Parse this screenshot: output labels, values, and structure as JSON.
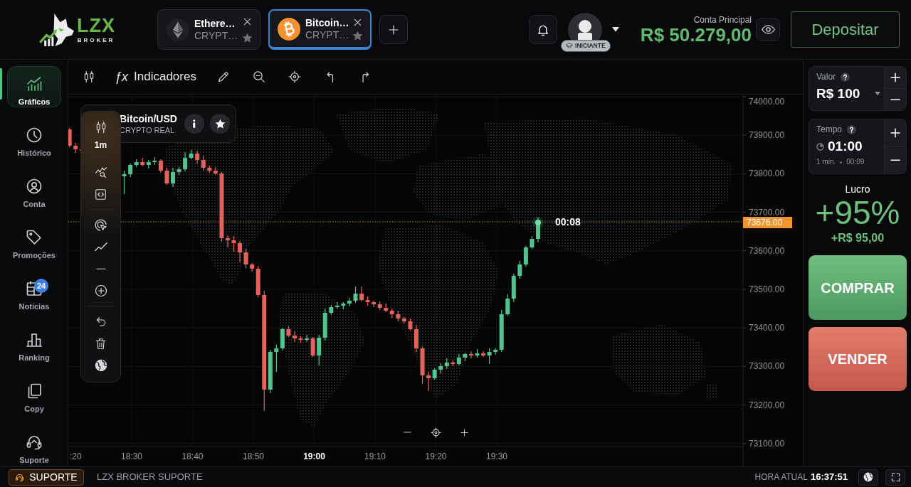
{
  "logo": {
    "wordmark": "LZX",
    "tagline": "BROKER"
  },
  "asset_tabs": [
    {
      "kind": "ethereum",
      "name": "Ethere…",
      "category": "CRYPT…",
      "selected": false
    },
    {
      "kind": "bitcoin",
      "name": "Bitcoin…",
      "category": "CRYPT…",
      "selected": true
    }
  ],
  "account": {
    "level_badge": "INICIANTE",
    "label": "Conta Principal",
    "balance": "R$ 50.279,00",
    "deposit_button": "Depositar"
  },
  "sidebar": {
    "items": [
      {
        "kind": "charts",
        "label": "Gráficos",
        "selected": true
      },
      {
        "kind": "history",
        "label": "Histórico",
        "selected": false
      },
      {
        "kind": "account",
        "label": "Conta",
        "selected": false
      },
      {
        "kind": "promotions",
        "label": "Promoções",
        "selected": false
      },
      {
        "kind": "news",
        "label": "Notícias",
        "selected": false,
        "badge": "24"
      },
      {
        "kind": "ranking",
        "label": "Ranking",
        "selected": false
      },
      {
        "kind": "copy",
        "label": "Copy",
        "selected": false
      },
      {
        "kind": "support",
        "label": "Suporte",
        "selected": false
      }
    ]
  },
  "chart_toolbar": {
    "indicators_symbol": "ƒx",
    "indicators_label": "Indicadores"
  },
  "asset_card": {
    "name": "Bitcoin/USD",
    "category": "CRYPTO REAL"
  },
  "drawing_tools": {
    "timeframe": "1m"
  },
  "chart": {
    "price_labels": [
      "74000.00",
      "73900.00",
      "73800.00",
      "73700.00",
      "73600.00",
      "73500.00",
      "73400.00",
      "73300.00",
      "73200.00",
      "73100.00"
    ],
    "current_price": "73676.00",
    "countdown": "00:08",
    "time_labels": [
      {
        "label": ":20",
        "major": false
      },
      {
        "label": "18:30",
        "major": false
      },
      {
        "label": "18:40",
        "major": false
      },
      {
        "label": "18:50",
        "major": false
      },
      {
        "label": "19:00",
        "major": true
      },
      {
        "label": "19:10",
        "major": false
      },
      {
        "label": "19:20",
        "major": false
      },
      {
        "label": "19:30",
        "major": false
      }
    ]
  },
  "trade_panel": {
    "amount": {
      "label": "Valor",
      "value": "R$ 100"
    },
    "duration": {
      "label": "Tempo",
      "value": "01:00",
      "unit": "1 min.",
      "remaining": "00:09"
    },
    "profit": {
      "label": "Lucro",
      "percent": "+95%",
      "amount": "+R$ 95,00"
    },
    "buy_button": "COMPRAR",
    "sell_button": "VENDER"
  },
  "footer": {
    "support_button": "SUPORTE",
    "support_title": "LZX BROKER SUPORTE",
    "clock_label": "HORA ATUAL",
    "clock_time": "16:37:51"
  }
}
